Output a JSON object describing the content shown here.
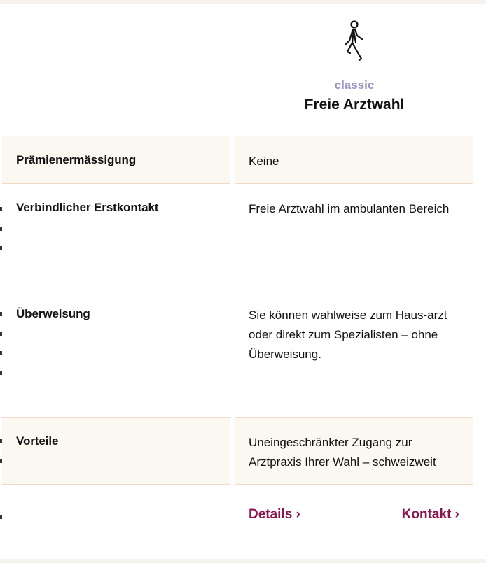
{
  "plan": {
    "icon": "walking-person-icon",
    "tier": "classic",
    "name": "Freie Arztwahl"
  },
  "rows": [
    {
      "label": "Prämienermässigung",
      "value": "Keine"
    },
    {
      "label": "Verbindlicher Erstkontakt",
      "value": "Freie Arztwahl im ambulanten Bereich"
    },
    {
      "label": "Überweisung",
      "value": "Sie können wahlweise zum Haus-arzt oder direkt zum Spezialisten – ohne Überweisung."
    },
    {
      "label": "Vorteile",
      "value": "Uneingeschränkter Zugang zur Arztpraxis Ihrer Wahl – schweizweit"
    }
  ],
  "links": {
    "details": "Details ›",
    "contact": "Kontakt ›"
  },
  "colors": {
    "accent_link": "#8c1550",
    "tier_label": "#9b94c4",
    "row_shade": "#fbf7f1",
    "divider": "#f0dcc6"
  }
}
